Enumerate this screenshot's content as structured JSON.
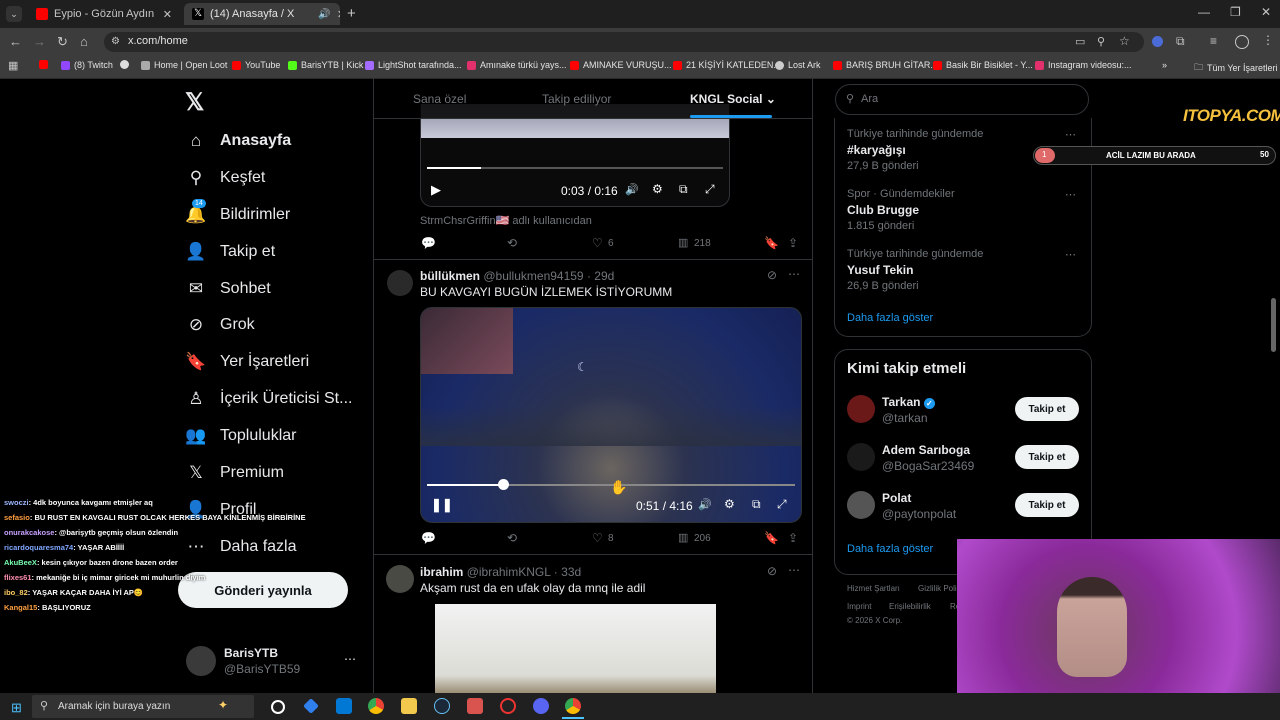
{
  "browser": {
    "tabs": [
      {
        "title": "Eypio - Gözün Aydın Günaydın!",
        "favicon_color": "#ff0000"
      },
      {
        "title": "(14) Anasayfa / X",
        "favicon_color": "#ffffff"
      }
    ],
    "url": "x.com/home",
    "bookmarks": [
      "(8) Twitch",
      "Home | Open Loot",
      "YouTube",
      "BarisYTB | Kick",
      "LightShot tarafında...",
      "Amınake türkü yays...",
      "AMINAKE VURUŞU...",
      "21 KİŞİYİ KATLEDEN...",
      "Lost Ark",
      "BARIŞ BRUH GİTAR...",
      "Basik Bir Bisiklet - Y...",
      "Instagram videosu:..."
    ],
    "bookmarks_folder": "Tüm Yer İşaretleri"
  },
  "sidebar": {
    "items": [
      {
        "label": "Anasayfa",
        "icon": "home-icon"
      },
      {
        "label": "Keşfet",
        "icon": "search-icon"
      },
      {
        "label": "Bildirimler",
        "icon": "bell-icon",
        "badge": "14"
      },
      {
        "label": "Takip et",
        "icon": "follow-icon"
      },
      {
        "label": "Sohbet",
        "icon": "mail-icon"
      },
      {
        "label": "Grok",
        "icon": "grok-icon"
      },
      {
        "label": "Yer İşaretleri",
        "icon": "bookmark-icon"
      },
      {
        "label": "İçerik Üreticisi St...",
        "icon": "creator-icon"
      },
      {
        "label": "Topluluklar",
        "icon": "communities-icon"
      },
      {
        "label": "Premium",
        "icon": "x-logo-icon"
      },
      {
        "label": "Profil",
        "icon": "profile-icon"
      },
      {
        "label": "Daha fazla",
        "icon": "more-icon"
      }
    ],
    "post_button": "Gönderi yayınla",
    "account": {
      "name": "BarisYTB",
      "handle": "@BarisYTB59"
    }
  },
  "feed": {
    "tabs": [
      "Sana özel",
      "Takip ediliyor",
      "KNGL Social"
    ],
    "tweet1": {
      "time": "0:03 / 0:16",
      "caption": "StrmChsrGriffin🇺🇸 adlı kullanıcıdan",
      "likes": "6",
      "views": "218"
    },
    "tweet2": {
      "name": "büllükmen",
      "handle": "@bullukmen94159",
      "age": "29d",
      "text": "BU KAVGAYI BUGÜN İZLEMEK İSTİYORUMM",
      "time": "0:51 / 4:16",
      "likes": "8",
      "views": "206",
      "progress": 0.2
    },
    "tweet3": {
      "name": "ibrahim",
      "handle": "@ibrahimKNGL",
      "age": "33d",
      "text": "Akşam rust da en ufak olay da  mnq ile adil"
    }
  },
  "right": {
    "search_placeholder": "Ara",
    "trends": [
      {
        "context": "Türkiye tarihinde gündemde",
        "title": "#karyağışı",
        "count": "27,9 B gönderi"
      },
      {
        "context": "Spor · Gündemdekiler",
        "title": "Club Brugge",
        "count": "1.815 gönderi"
      },
      {
        "context": "Türkiye tarihinde gündemde",
        "title": "Yusuf Tekin",
        "count": "26,9 B gönderi"
      }
    ],
    "show_more": "Daha fazla göster",
    "who_to_follow": "Kimi takip etmeli",
    "follow": [
      {
        "name": "Tarkan",
        "handle": "@tarkan",
        "verified": true
      },
      {
        "name": "Adem Sarıboga",
        "handle": "@BogaSar23469"
      },
      {
        "name": "Polat",
        "handle": "@paytonpolat"
      }
    ],
    "follow_label": "Takip et",
    "footer": [
      "Hizmet Şartları",
      "Gizlilik Poli",
      "Imprint",
      "Erişilebilirlik",
      "Re",
      "© 2026 X Corp."
    ]
  },
  "overlay": {
    "logo": "ITOPYA.COM",
    "goal_label": "ACİL LAZIM BU ARADA",
    "goal_start": "1",
    "goal_end": "50",
    "chat": [
      {
        "user": "swoczi",
        "msg": ": 4dk boyunca kavgamı etmişler aq",
        "color": "#9bb7ff"
      },
      {
        "user": "sefasio",
        "msg": ": BU RUST EN KAVGALI RUST OLCAK HERKES BAYA KİNLENMİŞ BİRBİRİNE",
        "color": "#ff9f43"
      },
      {
        "user": "onurakcakose",
        "msg": ": @barişytb geçmiş olsun özlendin",
        "color": "#c8a2ff"
      },
      {
        "user": "ricardoquaresma74",
        "msg": ": YAŞAR ABİİİİ",
        "color": "#7fa7ff"
      },
      {
        "user": "AkuBeeX",
        "msg": ": kesin çıkıyor bazen drone bazen order",
        "color": "#79ffb1"
      },
      {
        "user": "flixes61",
        "msg": ": mekaniğe bi iç mimar giricek mi muhurlin diyim",
        "color": "#ff8fb0"
      },
      {
        "user": "ibo_82",
        "msg": ": YAŞAR KAÇAR DAHA İYİ AP😊",
        "color": "#ffd166"
      },
      {
        "user": "Kangal15",
        "msg": ": BAŞLIYORUZ",
        "color": "#ff9f43"
      }
    ]
  },
  "taskbar": {
    "search_placeholder": "Aramak için buraya yazın"
  }
}
